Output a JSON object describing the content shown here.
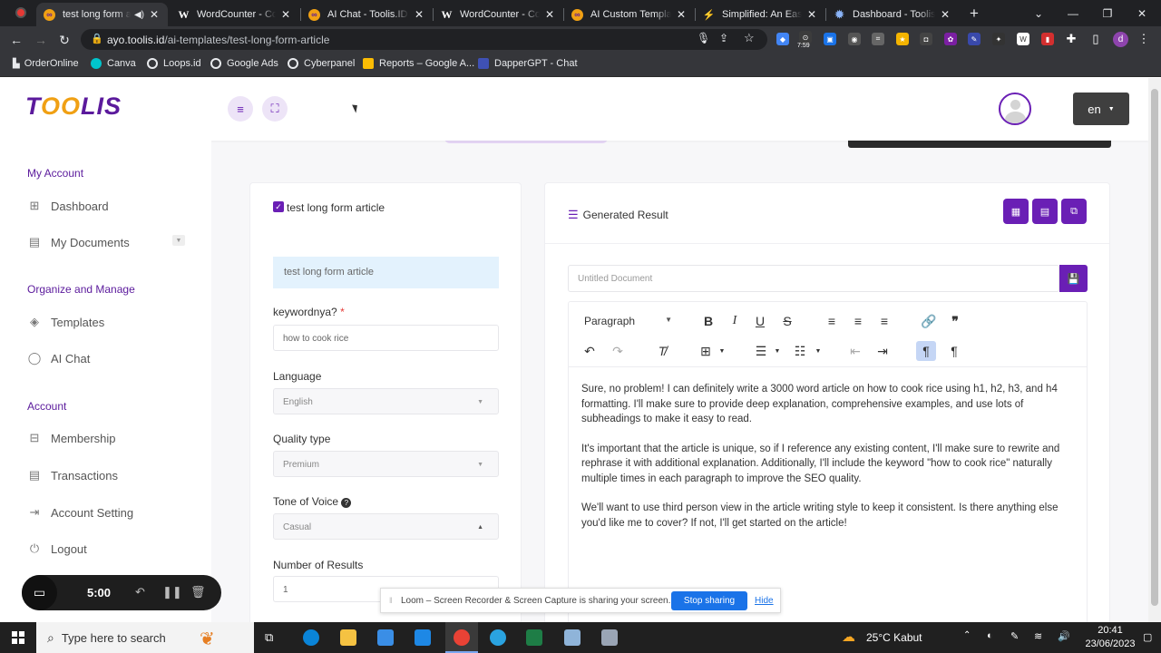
{
  "browser": {
    "tabs": [
      {
        "title": "test long form article",
        "active": true,
        "icon": "toolis-icon"
      },
      {
        "title": "WordCounter - Count Words",
        "icon": "w-icon"
      },
      {
        "title": "AI Chat - Toolis.ID - Toolis",
        "icon": "toolis-icon"
      },
      {
        "title": "WordCounter - Count Words",
        "icon": "w-icon"
      },
      {
        "title": "AI Custom Templates",
        "icon": "toolis-icon"
      },
      {
        "title": "Simplified: An Easy to Use",
        "icon": "simplified-icon"
      },
      {
        "title": "Dashboard - Toolis.ID",
        "icon": "gear-icon"
      }
    ],
    "url_host": "ayo.toolis.id",
    "url_path": "/ai-templates/test-long-form-article",
    "ext_time": "7:59",
    "bookmarks": [
      "OrderOnline",
      "Canva",
      "Loops.id",
      "Google Ads",
      "Cyberpanel",
      "Reports – Google A...",
      "DapperGPT - Chat"
    ]
  },
  "header": {
    "logo_pre": "T",
    "logo_oo": "OO",
    "logo_post": "LIS",
    "lang": "en"
  },
  "sidebar": {
    "sections": [
      {
        "title": "My Account",
        "items": [
          "Dashboard",
          "My Documents"
        ]
      },
      {
        "title": "Organize and Manage",
        "items": [
          "Templates",
          "AI Chat"
        ]
      },
      {
        "title": "Account",
        "items": [
          "Membership",
          "Transactions",
          "Account Setting",
          "Logout"
        ]
      }
    ]
  },
  "form": {
    "title": "test long form article",
    "section_title": "test long form article",
    "keyword_label": "keywordnya?",
    "keyword_required": "*",
    "keyword_value": "how to cook rice",
    "language_label": "Language",
    "language_value": "English",
    "quality_label": "Quality type",
    "quality_value": "Premium",
    "tone_label": "Tone of Voice",
    "tone_value": "Casual",
    "results_label": "Number of Results",
    "results_value": "1"
  },
  "result": {
    "title": "Generated Result",
    "doc_placeholder": "Untitled Document",
    "paragraph_style": "Paragraph",
    "paragraphs": [
      "Sure, no problem! I can definitely write a 3000 word article on how to cook rice using h1, h2, h3, and h4 formatting. I'll make sure to provide deep explanation, comprehensive examples, and use lots of subheadings to make it easy to read.",
      "It's important that the article is unique, so if I reference any existing content, I'll make sure to rewrite and rephrase it with additional explanation. Additionally, I'll include the keyword \"how to cook rice\" naturally multiple times in each paragraph to improve the SEO quality.",
      "We'll want to use third person view in the article writing style to keep it consistent. Is there anything else you'd like me to cover? If not, I'll get started on the article!"
    ]
  },
  "loom": {
    "timer": "5:00",
    "share_text": "Loom – Screen Recorder & Screen Capture is sharing your screen.",
    "stop_label": "Stop sharing",
    "hide_label": "Hide"
  },
  "taskbar": {
    "search_placeholder": "Type here to search",
    "weather": "25°C  Kabut",
    "time": "20:41",
    "date": "23/06/2023"
  },
  "colors": {
    "brand": "#6a1fb5",
    "accent": "#f0a014"
  }
}
